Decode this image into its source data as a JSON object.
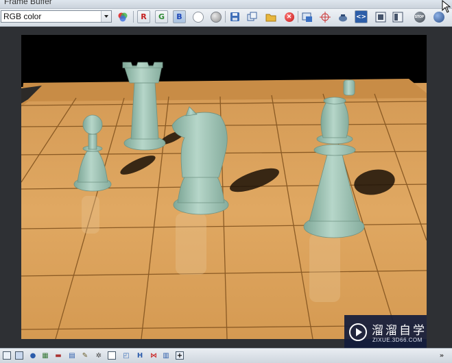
{
  "window": {
    "title": "Frame Buffer"
  },
  "toolbar": {
    "channel_select": {
      "value": "RGB color"
    },
    "red_channel_label": "R",
    "green_channel_label": "G",
    "blue_channel_label": "B"
  },
  "statusbar": {
    "h_label": "H",
    "expand_icon": "double-chevron-down"
  },
  "watermark": {
    "name": "溜溜自学",
    "url": "ZIXUE.3D66.COM"
  },
  "colors": {
    "board": "#d9a15a",
    "board_dark": "#a86f30",
    "pieces": "#9fc4b5",
    "viewport": "#2e3034"
  }
}
